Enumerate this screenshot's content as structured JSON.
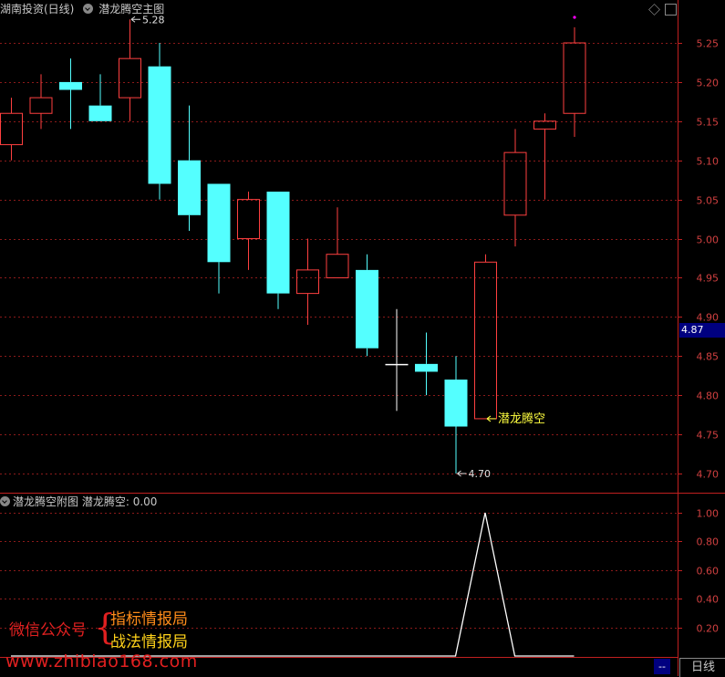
{
  "header": {
    "stock": "湖南投资(日线)",
    "indicator_main": "潜龙腾空主图"
  },
  "sub_header": {
    "indicator_sub": "潜龙腾空附图",
    "series_label": "潜龙腾空: 0.00"
  },
  "current_price": "4.87",
  "bottom": {
    "period_tab": "日线",
    "dash": "--"
  },
  "watermark": {
    "wechat": "微信公众号",
    "brace": "{",
    "line1": "指标情报局",
    "line2": "战法情报局",
    "site": "www.zhibiao168.com"
  },
  "colors": {
    "up": "#ff4040",
    "down": "#54ffff",
    "grid": "#8b1a1a",
    "axis": "#c02020",
    "label_yellow": "#ffff40",
    "marker": "#ff00ff"
  },
  "chart_data": [
    {
      "type": "candlestick",
      "ylim": [
        4.68,
        5.32
      ],
      "yticks": [
        "5.25",
        "5.20",
        "5.15",
        "5.10",
        "5.05",
        "5.00",
        "4.95",
        "4.90",
        "4.85",
        "4.80",
        "4.75",
        "4.70"
      ],
      "candles": [
        {
          "o": 5.12,
          "h": 5.18,
          "l": 5.1,
          "c": 5.16
        },
        {
          "o": 5.16,
          "h": 5.21,
          "l": 5.14,
          "c": 5.18
        },
        {
          "o": 5.2,
          "h": 5.23,
          "l": 5.14,
          "c": 5.19
        },
        {
          "o": 5.17,
          "h": 5.21,
          "l": 5.15,
          "c": 5.15
        },
        {
          "o": 5.18,
          "h": 5.28,
          "l": 5.15,
          "c": 5.23
        },
        {
          "o": 5.22,
          "h": 5.25,
          "l": 5.05,
          "c": 5.07
        },
        {
          "o": 5.1,
          "h": 5.17,
          "l": 5.01,
          "c": 5.03
        },
        {
          "o": 5.07,
          "h": 5.07,
          "l": 4.93,
          "c": 4.97
        },
        {
          "o": 5.0,
          "h": 5.06,
          "l": 4.96,
          "c": 5.05
        },
        {
          "o": 5.06,
          "h": 5.06,
          "l": 4.91,
          "c": 4.93
        },
        {
          "o": 4.93,
          "h": 5.0,
          "l": 4.89,
          "c": 4.96
        },
        {
          "o": 4.95,
          "h": 5.04,
          "l": 4.95,
          "c": 4.98
        },
        {
          "o": 4.96,
          "h": 4.98,
          "l": 4.85,
          "c": 4.86
        },
        {
          "o": 4.84,
          "h": 4.91,
          "l": 4.78,
          "c": 4.84
        },
        {
          "o": 4.84,
          "h": 4.88,
          "l": 4.8,
          "c": 4.83
        },
        {
          "o": 4.82,
          "h": 4.85,
          "l": 4.7,
          "c": 4.76
        },
        {
          "o": 4.77,
          "h": 4.98,
          "l": 4.77,
          "c": 4.97
        },
        {
          "o": 5.03,
          "h": 5.14,
          "l": 4.99,
          "c": 5.11
        },
        {
          "o": 5.14,
          "h": 5.16,
          "l": 5.05,
          "c": 5.15
        },
        {
          "o": 5.16,
          "h": 5.27,
          "l": 5.13,
          "c": 5.25
        }
      ],
      "annotations": [
        {
          "text": "5.28",
          "candle": 4,
          "price": 5.28
        },
        {
          "text": "4.70",
          "candle": 15,
          "price": 4.7
        },
        {
          "text": "潜龙腾空",
          "candle": 16,
          "price": 4.77
        }
      ]
    },
    {
      "type": "line",
      "name": "潜龙腾空",
      "ylim": [
        0,
        1.1
      ],
      "yticks": [
        "1.00",
        "0.80",
        "0.60",
        "0.40",
        "0.20"
      ],
      "values": [
        0,
        0,
        0,
        0,
        0,
        0,
        0,
        0,
        0,
        0,
        0,
        0,
        0,
        0,
        0,
        0,
        1,
        0,
        0,
        0
      ]
    }
  ]
}
